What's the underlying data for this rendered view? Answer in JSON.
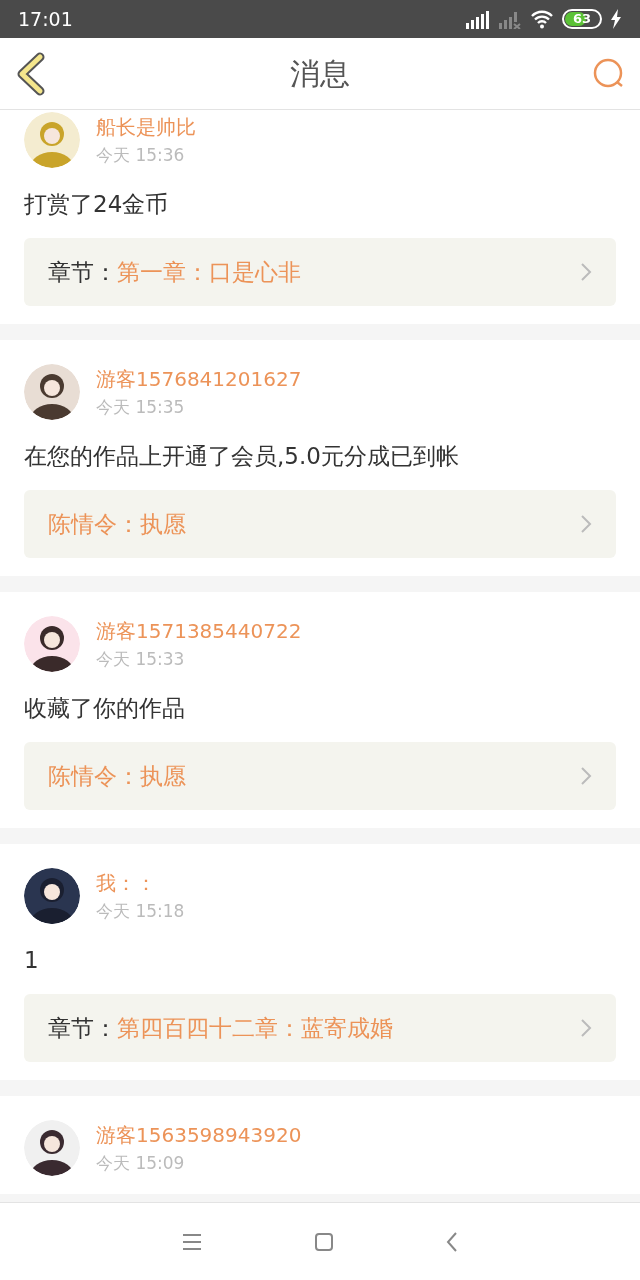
{
  "status_bar": {
    "time": "17:01",
    "battery": "63"
  },
  "header": {
    "title": "消息"
  },
  "messages": [
    {
      "name": "船长是帅比",
      "time": "今天 15:36",
      "text": "打赏了24金币",
      "link": {
        "label": "章节：",
        "title": "第一章：口是心非"
      }
    },
    {
      "name": "游客1576841201627",
      "time": "今天 15:35",
      "text": "在您的作品上开通了会员,5.0元分成已到帐",
      "link": {
        "title": "陈情令：执愿"
      }
    },
    {
      "name": "游客1571385440722",
      "time": "今天 15:33",
      "text": "收藏了你的作品",
      "link": {
        "title": "陈情令：执愿"
      }
    },
    {
      "name": "我：：",
      "time": "今天 15:18",
      "text": "1",
      "link": {
        "label": "章节：",
        "title": "第四百四十二章：蓝寄成婚"
      }
    },
    {
      "name": "游客1563598943920",
      "time": "今天 15:09"
    }
  ]
}
